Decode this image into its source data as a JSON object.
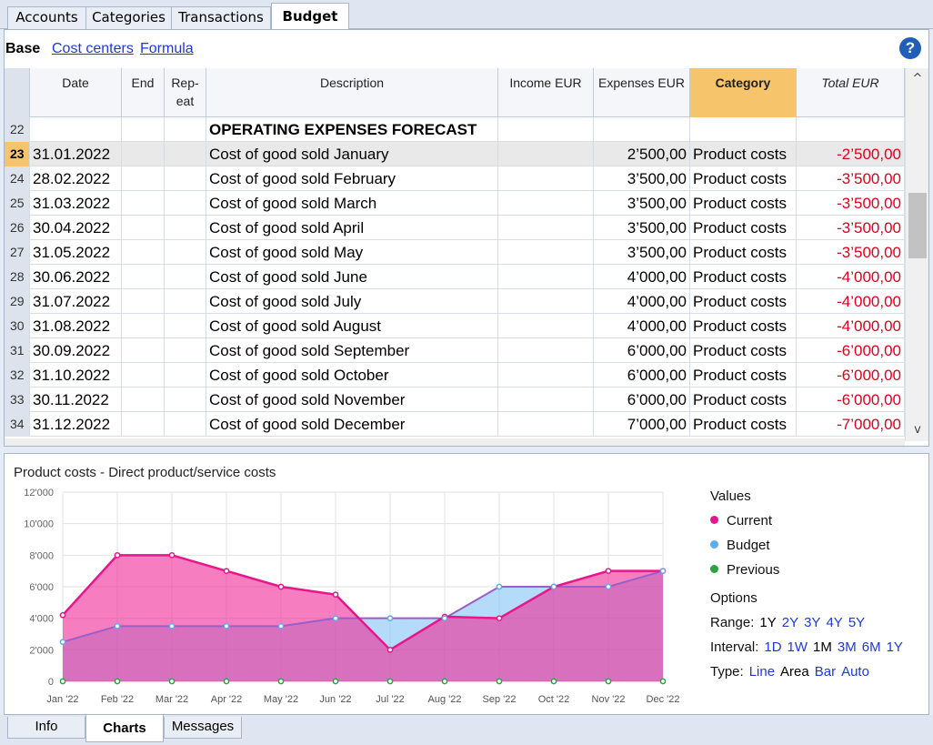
{
  "top_tabs": [
    "Accounts",
    "Categories",
    "Transactions",
    "Budget"
  ],
  "view": {
    "base": "Base",
    "links": [
      "Cost centers",
      "Formula"
    ],
    "help": "?"
  },
  "columns": [
    "Date",
    "End",
    "Rep-\neat",
    "Description",
    "Income EUR",
    "Expenses EUR",
    "Category",
    "Total EUR"
  ],
  "rows": [
    {
      "n": "22",
      "date": "",
      "desc": "OPERATING EXPENSES FORECAST",
      "exp": "",
      "cat": "",
      "total": ""
    },
    {
      "n": "23",
      "date": "31.01.2022",
      "desc": "Cost of good sold January",
      "exp": "2’500,00",
      "cat": "Product costs",
      "total": "-2’500,00"
    },
    {
      "n": "24",
      "date": "28.02.2022",
      "desc": "Cost of good sold February",
      "exp": "3’500,00",
      "cat": "Product costs",
      "total": "-3’500,00"
    },
    {
      "n": "25",
      "date": "31.03.2022",
      "desc": "Cost of good sold March",
      "exp": "3’500,00",
      "cat": "Product costs",
      "total": "-3’500,00"
    },
    {
      "n": "26",
      "date": "30.04.2022",
      "desc": "Cost of good sold April",
      "exp": "3’500,00",
      "cat": "Product costs",
      "total": "-3’500,00"
    },
    {
      "n": "27",
      "date": "31.05.2022",
      "desc": "Cost of good sold May",
      "exp": "3’500,00",
      "cat": "Product costs",
      "total": "-3’500,00"
    },
    {
      "n": "28",
      "date": "30.06.2022",
      "desc": "Cost of good sold June",
      "exp": "4’000,00",
      "cat": "Product costs",
      "total": "-4’000,00"
    },
    {
      "n": "29",
      "date": "31.07.2022",
      "desc": "Cost of good sold July",
      "exp": "4’000,00",
      "cat": "Product costs",
      "total": "-4’000,00"
    },
    {
      "n": "30",
      "date": "31.08.2022",
      "desc": "Cost of good sold August",
      "exp": "4’000,00",
      "cat": "Product costs",
      "total": "-4’000,00"
    },
    {
      "n": "31",
      "date": "30.09.2022",
      "desc": "Cost of good sold September",
      "exp": "6’000,00",
      "cat": "Product costs",
      "total": "-6’000,00"
    },
    {
      "n": "32",
      "date": "31.10.2022",
      "desc": "Cost of good sold October",
      "exp": "6’000,00",
      "cat": "Product costs",
      "total": "-6’000,00"
    },
    {
      "n": "33",
      "date": "30.11.2022",
      "desc": "Cost of good sold November",
      "exp": "6’000,00",
      "cat": "Product costs",
      "total": "-6’000,00"
    },
    {
      "n": "34",
      "date": "31.12.2022",
      "desc": "Cost of good sold December",
      "exp": "7’000,00",
      "cat": "Product costs",
      "total": "-7’000,00"
    }
  ],
  "selected_row": "23",
  "scroll": {
    "up": "^",
    "down": "v"
  },
  "chart": {
    "title": "Product costs - Direct product/service costs",
    "legend_title": "Values",
    "series_labels": [
      "Current",
      "Budget",
      "Previous"
    ],
    "options_title": "Options",
    "range_label": "Range:",
    "range": [
      "1Y",
      "2Y",
      "3Y",
      "4Y",
      "5Y"
    ],
    "range_selected": "1Y",
    "interval_label": "Interval:",
    "interval": [
      "1D",
      "1W",
      "1M",
      "3M",
      "6M",
      "1Y"
    ],
    "interval_selected": "1M",
    "type_label": "Type:",
    "types": [
      "Line",
      "Area",
      "Bar",
      "Auto"
    ],
    "type_selected": "Area"
  },
  "chart_data": {
    "type": "area",
    "categories": [
      "Jan '22",
      "Feb '22",
      "Mar '22",
      "Apr '22",
      "May '22",
      "Jun '22",
      "Jul '22",
      "Aug '22",
      "Sep '22",
      "Oct '22",
      "Nov '22",
      "Dec '22"
    ],
    "y_ticks": [
      "0",
      "2'000",
      "4'000",
      "6'000",
      "8'000",
      "10'000",
      "12'000"
    ],
    "ylim": [
      0,
      12000
    ],
    "series": [
      {
        "name": "Current",
        "color": "#e8168c",
        "values": [
          4200,
          8000,
          8000,
          7000,
          6000,
          5500,
          2000,
          4100,
          4000,
          6000,
          7000,
          7000
        ]
      },
      {
        "name": "Budget",
        "color": "#5aacf0",
        "values": [
          2500,
          3500,
          3500,
          3500,
          3500,
          4000,
          4000,
          4000,
          6000,
          6000,
          6000,
          7000
        ]
      },
      {
        "name": "Previous",
        "color": "#2aa53a",
        "values": [
          0,
          0,
          0,
          0,
          0,
          0,
          0,
          0,
          0,
          0,
          0,
          0
        ]
      }
    ],
    "grid": true,
    "legend": "right"
  },
  "bottom_tabs": [
    "Info",
    "Charts",
    "Messages"
  ],
  "colors": {
    "header_accent": "#f6c46a",
    "negative": "#e0001b",
    "link": "#1c3ad8"
  }
}
